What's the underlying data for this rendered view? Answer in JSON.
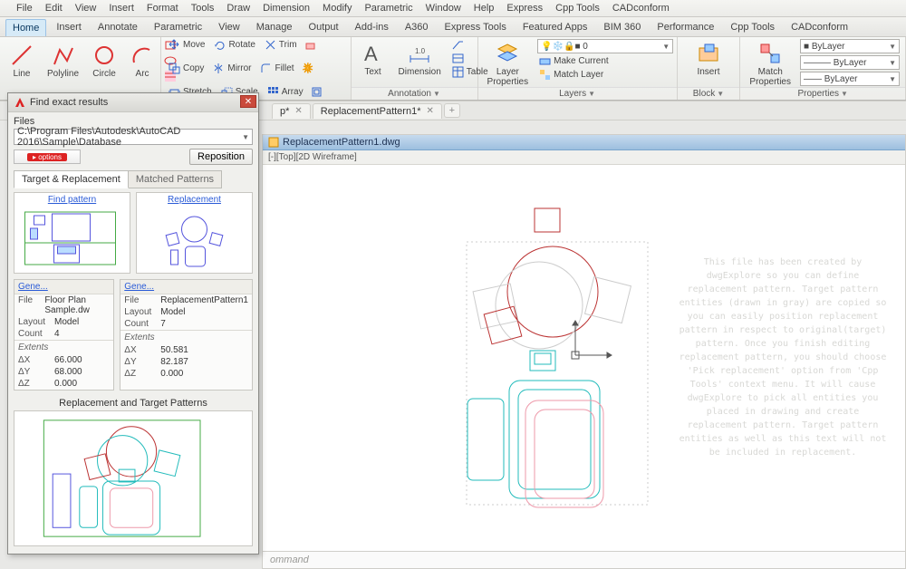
{
  "menus": [
    "File",
    "Edit",
    "View",
    "Insert",
    "Format",
    "Tools",
    "Draw",
    "Dimension",
    "Modify",
    "Parametric",
    "Window",
    "Help",
    "Express",
    "Cpp Tools",
    "CADconform"
  ],
  "ribbon_tabs": [
    "Home",
    "Insert",
    "Annotate",
    "Parametric",
    "View",
    "Manage",
    "Output",
    "Add-ins",
    "A360",
    "Express Tools",
    "Featured Apps",
    "BIM 360",
    "Performance",
    "Cpp Tools",
    "CADconform"
  ],
  "ribbon": {
    "draw": {
      "line": "Line",
      "polyline": "Polyline",
      "circle": "Circle",
      "arc": "Arc"
    },
    "modify": {
      "move": "Move",
      "copy": "Copy",
      "stretch": "Stretch",
      "rotate": "Rotate",
      "mirror": "Mirror",
      "scale": "Scale",
      "trim": "Trim",
      "fillet": "Fillet",
      "array": "Array"
    },
    "annotation": {
      "text": "Text",
      "dimension": "Dimension",
      "table": "Table",
      "label": "Annotation"
    },
    "layers": {
      "btn": "Layer\nProperties",
      "makecurrent": "Make Current",
      "matchlayer": "Match Layer",
      "label": "Layers"
    },
    "block": {
      "insert": "Insert",
      "label": "Block"
    },
    "props": {
      "match": "Match\nProperties",
      "bylayer": "ByLayer",
      "label": "Properties"
    }
  },
  "doc_tabs": {
    "tab1_suffix": "p*",
    "tab2": "ReplacementPattern1*",
    "plus": "+"
  },
  "filebar": "ReplacementPattern1.dwg",
  "viewtag": "[-][Top][2D Wireframe]",
  "cmdline": "ommand",
  "ghost": "This file has been created by dwgExplore so you can define replacement pattern. Target pattern entities (drawn in gray) are copied so you can easily position replacement pattern in respect to original(target) pattern. Once you finish editing replacement pattern, you should choose 'Pick replacement' option from 'Cpp Tools' context menu. It will cause dwgExplore to pick all entities you placed in drawing and create replacement pattern. Target pattern entities as well as this text will not be included in replacement.",
  "panel": {
    "title": "Find exact results",
    "files_label": "Files",
    "path": "C:\\Program Files\\Autodesk\\AutoCAD 2016\\Sample\\Database",
    "reposition": "Reposition",
    "subtab1": "Target & Replacement",
    "subtab2": "Matched Patterns",
    "findpattern": "Find pattern",
    "replacement": "Replacement",
    "gene": "Gene...",
    "extents": "Extents",
    "merged_label": "Replacement and Target Patterns",
    "left": {
      "File": "Floor Plan Sample.dw",
      "Layout": "Model",
      "Count": "4",
      "dX": "66.000",
      "dY": "68.000",
      "dZ": "0.000"
    },
    "right": {
      "File": "ReplacementPattern1",
      "Layout": "Model",
      "Count": "7",
      "dX": "50.581",
      "dY": "82.187",
      "dZ": "0.000"
    },
    "keys": {
      "file": "File",
      "layout": "Layout",
      "count": "Count",
      "dx": "ΔX",
      "dy": "ΔY",
      "dz": "ΔZ"
    }
  }
}
